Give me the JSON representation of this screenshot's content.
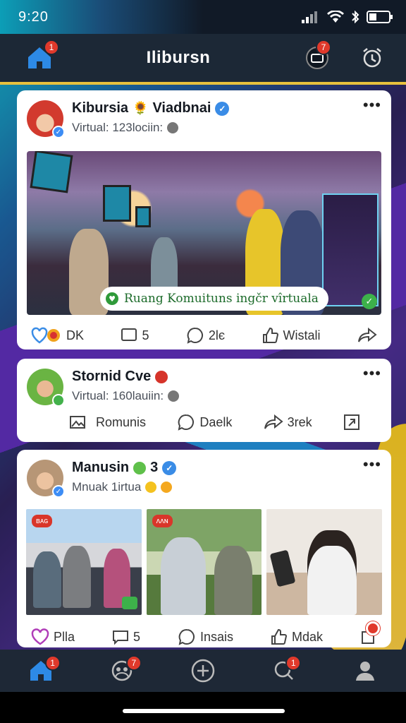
{
  "status_bar": {
    "time": "9:20",
    "icons": [
      "signal-icon",
      "wifi-icon",
      "bluetooth-icon",
      "battery-icon"
    ]
  },
  "top_bar": {
    "title": "Ilibursn",
    "home_badge": "1",
    "notifications_badge": "7"
  },
  "posts": [
    {
      "author": "Kibursia",
      "author_rest": "Viadbnai",
      "subtitle": "Virtual: 123lociin:",
      "photo_label": "Ruang Komuituns ingčr vîrtuala",
      "actions": {
        "react": "DK",
        "comments": "5",
        "share": "2lє",
        "like": "Wistali"
      }
    },
    {
      "author": "Stornid Cve",
      "subtitle": "Virtual: 160lauiin:",
      "actions": {
        "community": "Romunis",
        "reply": "Daelk",
        "share": "3rek"
      }
    },
    {
      "author": "Manusin",
      "author_rest": "3",
      "subtitle": "Mnuak 1irtua",
      "tags": [
        "ʙᴀɢ",
        "ᴧᴧɴ"
      ],
      "actions": {
        "react": "Plla",
        "comments": "5",
        "reply": "Insais",
        "like": "Mdak"
      }
    }
  ],
  "bottom_nav": {
    "home_badge": "1",
    "community_badge": "7",
    "search_badge": "1"
  },
  "colors": {
    "accent": "#e8c13d",
    "badge": "#e0392b",
    "blue": "#3a8ce6"
  }
}
